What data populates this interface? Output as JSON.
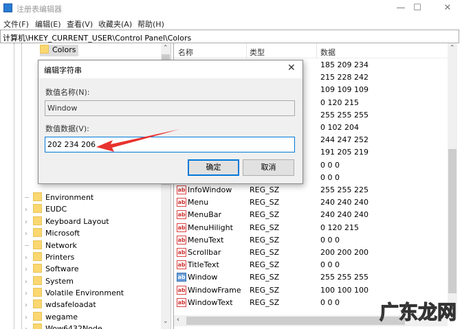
{
  "window": {
    "title": "注册表编辑器",
    "min": "—",
    "max": "☐",
    "close": "✕"
  },
  "menu": [
    "文件(F)",
    "编辑(E)",
    "查看(V)",
    "收藏夹(A)",
    "帮助(H)"
  ],
  "address": "计算机\\HKEY_CURRENT_USER\\Control Panel\\Colors",
  "tree": {
    "selected": "Colors",
    "items": [
      "Environment",
      "EUDC",
      "Keyboard Layout",
      "Microsoft",
      "Network",
      "Printers",
      "Software",
      "System",
      "Volatile Environment",
      "wdsafeloadat",
      "wegame",
      "Wow6432Node"
    ]
  },
  "list": {
    "headers": [
      "名称",
      "类型",
      "数据"
    ],
    "rows": [
      {
        "name": "",
        "type": "",
        "data": "185 209 234"
      },
      {
        "name": "",
        "type": "",
        "data": "215 228 242"
      },
      {
        "name": "",
        "type": "",
        "data": "109 109 109"
      },
      {
        "name": "",
        "type": "",
        "data": "0 120 215"
      },
      {
        "name": "",
        "type": "",
        "data": "255 255 255"
      },
      {
        "name": "",
        "type": "",
        "data": "0 102 204"
      },
      {
        "name": "",
        "type": "",
        "data": "244 247 252"
      },
      {
        "name": "",
        "type": "",
        "data": "191 205 219"
      },
      {
        "name": "",
        "type": "",
        "data": "0 0 0"
      },
      {
        "name": "",
        "type": "",
        "data": "0 0 0"
      },
      {
        "name": "InfoWindow",
        "type": "REG_SZ",
        "data": "255 255 225"
      },
      {
        "name": "Menu",
        "type": "REG_SZ",
        "data": "240 240 240"
      },
      {
        "name": "MenuBar",
        "type": "REG_SZ",
        "data": "240 240 240"
      },
      {
        "name": "MenuHilight",
        "type": "REG_SZ",
        "data": "0 120 215"
      },
      {
        "name": "MenuText",
        "type": "REG_SZ",
        "data": "0 0 0"
      },
      {
        "name": "Scrollbar",
        "type": "REG_SZ",
        "data": "200 200 200"
      },
      {
        "name": "TitleText",
        "type": "REG_SZ",
        "data": "0 0 0"
      },
      {
        "name": "Window",
        "type": "REG_SZ",
        "data": "255 255 255",
        "selected": true
      },
      {
        "name": "WindowFrame",
        "type": "REG_SZ",
        "data": "100 100 100"
      },
      {
        "name": "WindowText",
        "type": "REG_SZ",
        "data": "0 0 0"
      }
    ]
  },
  "dialog": {
    "title": "编辑字符串",
    "name_label": "数值名称(N):",
    "name_value": "Window",
    "data_label": "数值数据(V):",
    "data_value": "202 234 206",
    "ok": "确定",
    "cancel": "取消"
  },
  "watermark": "广东龙网",
  "colors": {
    "arrow": "#e8322f",
    "accent": "#0078d7"
  }
}
